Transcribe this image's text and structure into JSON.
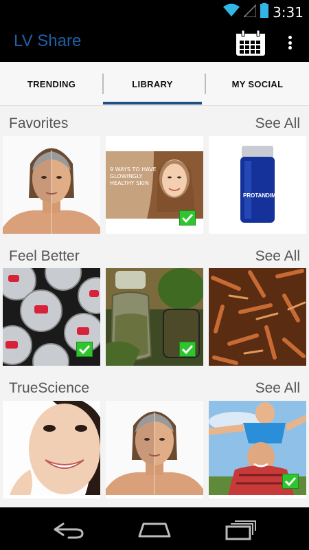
{
  "status": {
    "time": "3:31"
  },
  "app": {
    "title": "LV Share"
  },
  "tabs": [
    {
      "label": "TRENDING"
    },
    {
      "label": "LIBRARY"
    },
    {
      "label": "MY SOCIAL"
    }
  ],
  "sections": [
    {
      "title": "Favorites",
      "see_all": "See All",
      "tiles": [
        {
          "name": "aging-face-comparison",
          "checked": false
        },
        {
          "name": "healthy-skin-article",
          "caption": "9 WAYS TO HAVE GLOWINGLY HEALTHY SKIN",
          "checked": true
        },
        {
          "name": "protandim-bottle",
          "label": "PROTANDIM",
          "checked": false
        }
      ]
    },
    {
      "title": "Feel Better",
      "see_all": "See All",
      "tiles": [
        {
          "name": "energy-drink-cans",
          "checked": true
        },
        {
          "name": "herbal-jars",
          "checked": true
        },
        {
          "name": "wood-chips",
          "checked": false
        }
      ]
    },
    {
      "title": "TrueScience",
      "see_all": "See All",
      "tiles": [
        {
          "name": "smiling-woman",
          "checked": false
        },
        {
          "name": "aging-face-comparison-2",
          "checked": false
        },
        {
          "name": "father-son-outdoors",
          "checked": true
        }
      ]
    }
  ]
}
